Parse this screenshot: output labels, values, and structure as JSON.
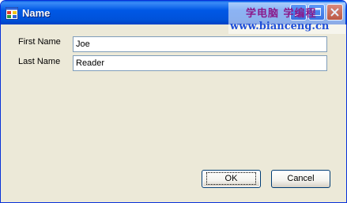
{
  "window": {
    "title": "Name",
    "icon": "app-window-icon"
  },
  "watermark": {
    "line1": "学电脑 学编程",
    "line2": "www.bianceng.cn"
  },
  "form": {
    "first_name_label": "First Name",
    "first_name_value": "Joe",
    "last_name_label": "Last Name",
    "last_name_value": "Reader"
  },
  "buttons": {
    "ok_label": "OK",
    "cancel_label": "Cancel"
  },
  "caption_buttons": [
    "minimize-icon",
    "maximize-icon",
    "close-icon"
  ],
  "colors": {
    "titlebar": "#0058e6",
    "dialog_background": "#ece9d8",
    "textbox_border": "#7f9db9"
  }
}
